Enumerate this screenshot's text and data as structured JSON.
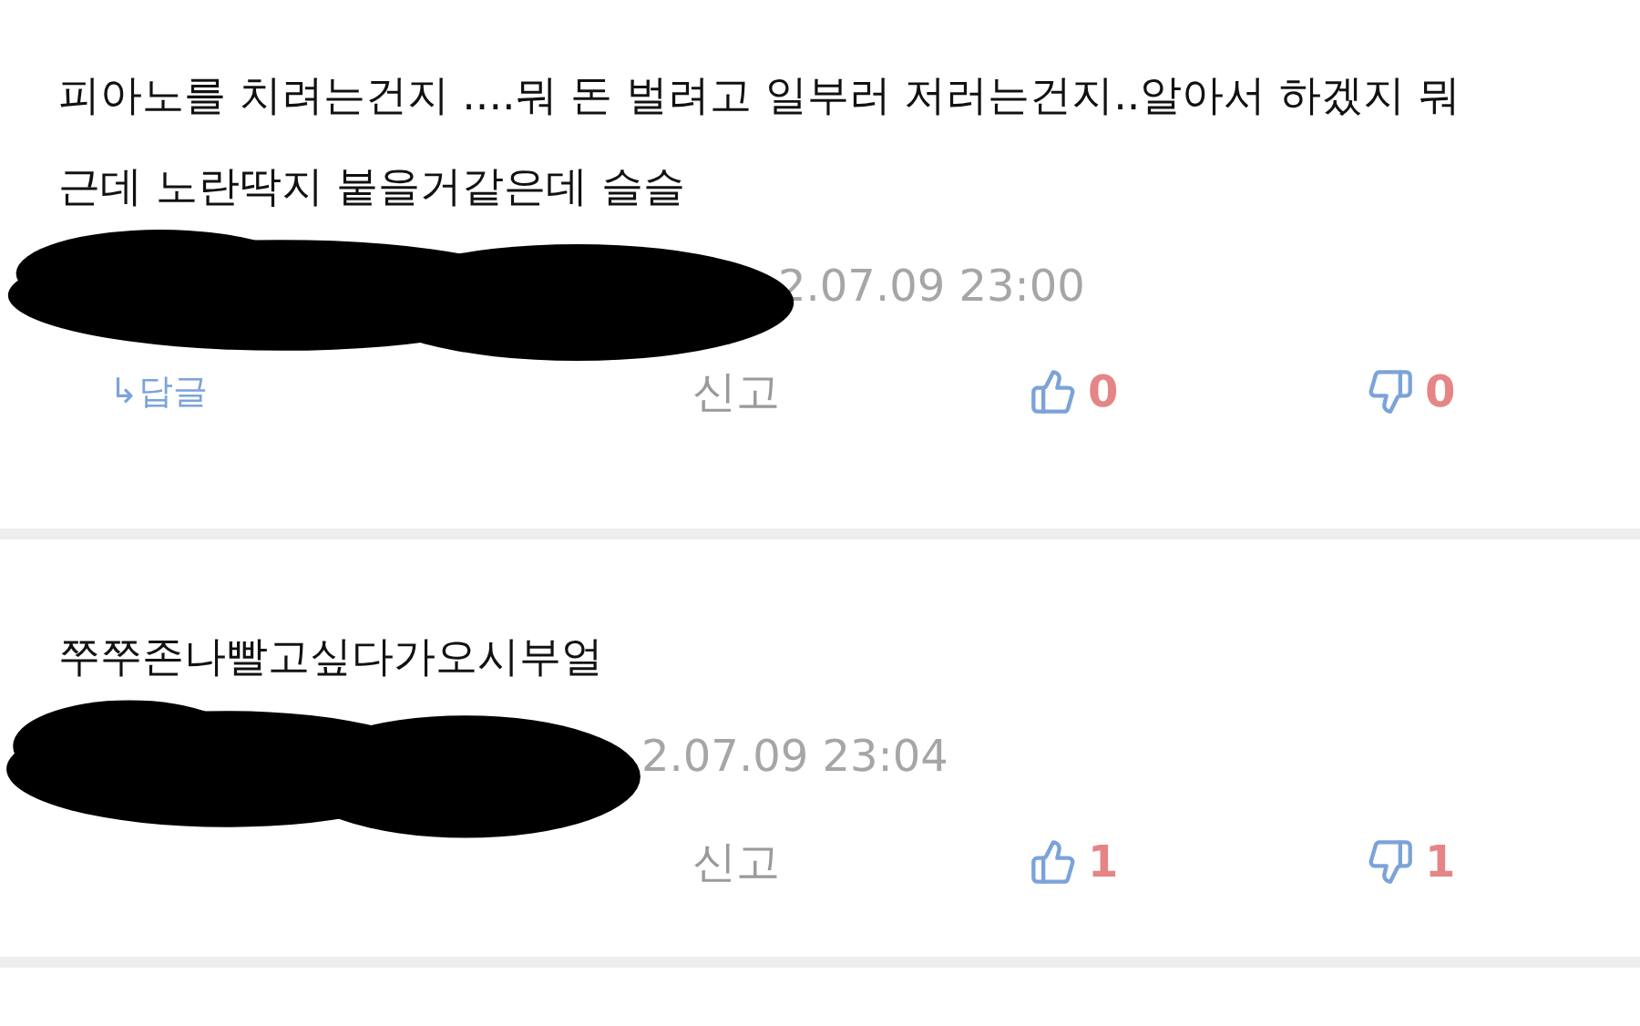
{
  "comments": [
    {
      "lines": [
        "피아노를 치려는건지 ....뭐 돈 벌려고 일부러 저러는건지..알아서 하겠지 뭐",
        "근데 노란딱지 붙을거같은데 슬슬"
      ],
      "timestamp": "2.07.09 23:00",
      "reply": "↳답글",
      "report": "신고",
      "likes": "0",
      "dislikes": "0"
    },
    {
      "lines": [
        "쭈쭈존나빨고싶다가오시부얼"
      ],
      "timestamp": "2.07.09 23:04",
      "report": "신고",
      "likes": "1",
      "dislikes": "1"
    }
  ]
}
